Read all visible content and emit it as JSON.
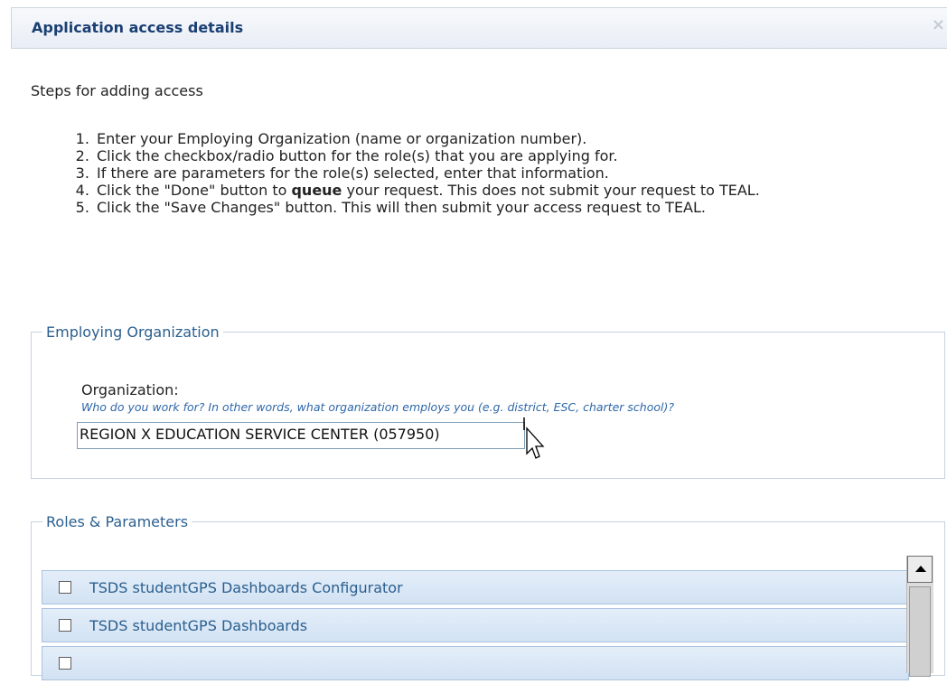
{
  "dialog": {
    "title": "Application access details"
  },
  "intro": "Steps for adding access",
  "steps": [
    "Enter your Employing Organization (name or organization number).",
    "Click the checkbox/radio button for the role(s) that you are applying for.",
    "If there are parameters for the role(s) selected, enter that information.",
    "Click the \"Done\" button to",
    "queue",
    "your request. This does not submit your request to TEAL.",
    "Click the \"Save Changes\" button. This will then submit your access request to TEAL."
  ],
  "employing_org": {
    "legend": "Employing Organization",
    "label": "Organization:",
    "help": "Who do you work for? In other words, what organization employs you (e.g. district, ESC, charter school)?",
    "value": "REGION X EDUCATION SERVICE CENTER (057950)"
  },
  "roles": {
    "legend": "Roles & Parameters",
    "items": [
      {
        "label": "TSDS studentGPS Dashboards Configurator",
        "checked": false
      },
      {
        "label": "TSDS studentGPS Dashboards",
        "checked": false
      },
      {
        "label": "",
        "checked": false
      }
    ]
  },
  "colors": {
    "title": "#1a3f73",
    "legend": "#2b5f8f",
    "help": "#2e67a8",
    "role_bg": "#d9e7f6"
  }
}
